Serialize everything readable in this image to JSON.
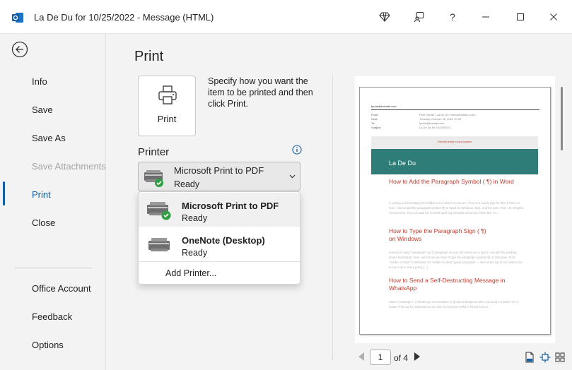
{
  "window": {
    "title": "La De Du for 10/25/2022  -  Message (HTML)",
    "accent": "#115ea3",
    "buttons": {
      "help": "?"
    }
  },
  "nav": {
    "items": [
      {
        "label": "Info"
      },
      {
        "label": "Save"
      },
      {
        "label": "Save As"
      },
      {
        "label": "Save Attachments",
        "disabled": true
      },
      {
        "label": "Print",
        "active": true
      },
      {
        "label": "Close"
      },
      {
        "label": "Office Account"
      },
      {
        "label": "Feedback"
      },
      {
        "label": "Options"
      }
    ]
  },
  "print": {
    "title": "Print",
    "button_label": "Print",
    "instructions": "Specify how you want the item to be printed and then click Print.",
    "printer_header": "Printer",
    "selected_printer": {
      "name": "Microsoft Print to PDF",
      "status": "Ready"
    },
    "printers": [
      {
        "name": "Microsoft Print to PDF",
        "status": "Ready"
      },
      {
        "name": "OneNote (Desktop)",
        "status": "Ready"
      }
    ],
    "add_printer": "Add Printer..."
  },
  "preview": {
    "from_email": "fpreal@hotmail.com",
    "fields": [
      {
        "k": "From:",
        "v": "Pete Hunter | La De Du <hello@ladedu.com>"
      },
      {
        "k": "Sent:",
        "v": "Tuesday, October 25, 2022 10:09"
      },
      {
        "k": "To:",
        "v": "fpreal@hotmail.com"
      },
      {
        "k": "Subject:",
        "v": "La De Du for 10/25/2022"
      }
    ],
    "banner_link": "View this email in your browser",
    "header_text": "La De Du",
    "teal": "#2e7d78",
    "articles": [
      {
        "title": "How to Add the Paragraph Symbol ( ¶) in Word",
        "body": "In writing and formatting it's helpful to see what's on-screen. There's a handy sign for that. Follow us here. How to add the paragraph symbol (¶) in Word for Windows, Mac, and the web. Post: UK Weights Conversions. If you do add the invisible stuff, tap what the document looks like. It's ..."
      },
      {
        "title": "How to Type the Paragraph Sign ( ¶) on Windows",
        "body": "Instead of using \"paragraph\" each paragraph on your document are a space, not with the working phone keyboards. Here, we'll show you how to type the paragraph symbol (¶) on Windows. Post: \"Adobe Acrobat\" in Windows 10 \"Adobe Acrobat\" guide paragraph — here at the top of our hotline doc to see it all in every policy [...]"
      },
      {
        "title": "How to Send a Self-Destructing Message in WhatsApp",
        "body": "Want a message in a WhatsApp conversation or group to disappear after you send it a while? It's a feature that can be switched on per chat so everyone within it knows how to..."
      }
    ],
    "page_current": "1",
    "page_of": "of 4"
  }
}
